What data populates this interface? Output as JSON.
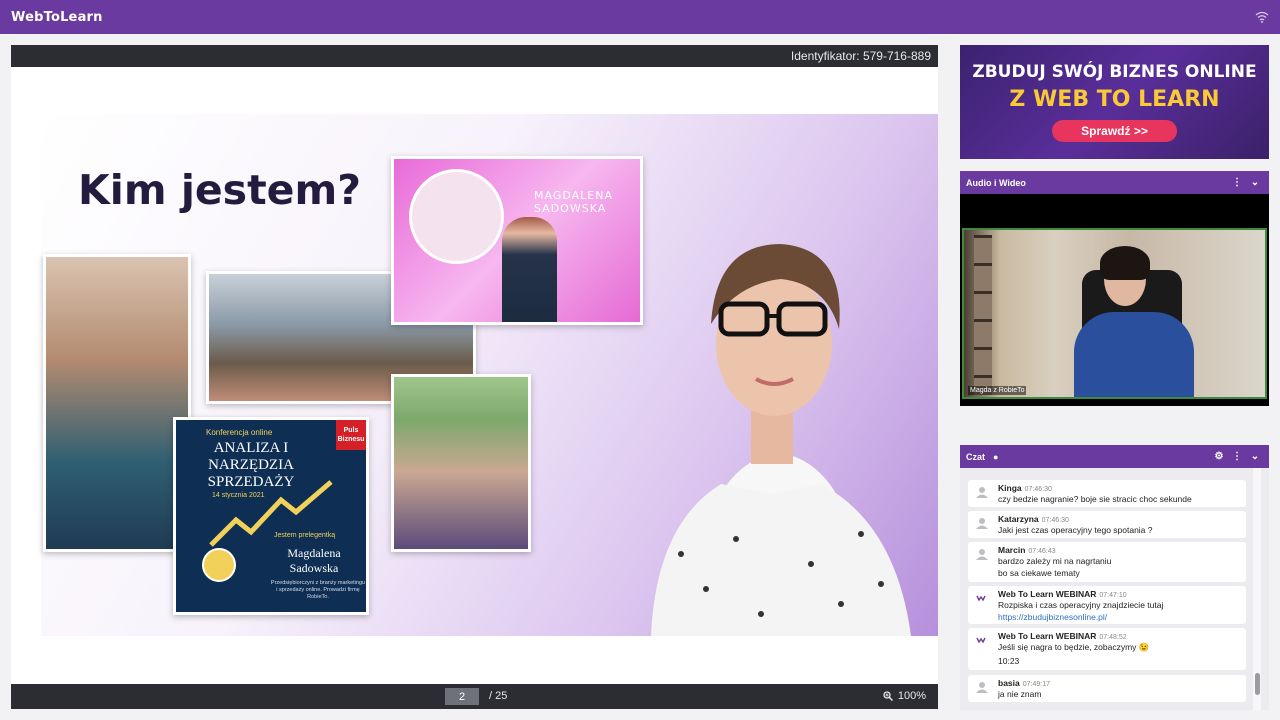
{
  "app": {
    "logo": "WebToLearn"
  },
  "presentation": {
    "identifier": "Identyfikator: 579-716-889",
    "page": "2",
    "page_total": "/ 25",
    "zoom": "100%",
    "slide": {
      "title": "Kim jestem?",
      "pink_card_name": "MAGDALENA SADOWSKA",
      "conference": {
        "kicker": "Konferencja online",
        "title": "ANALIZA I NARZĘDZIA SPRZEDAŻY",
        "date": "14 stycznia 2021",
        "badge": "Puls Biznesu",
        "speaker_label": "Jestem prelegentką",
        "speaker_name": "Magdalena Sadowska",
        "description": "Przedsiębiorczyni z branży marketingu i sprzedaży online. Prowadzi firmę RobieTo."
      }
    }
  },
  "ad": {
    "line1": "ZBUDUJ SWÓJ BIZNES ONLINE",
    "line2": "Z WEB TO LEARN",
    "button": "Sprawdź >>"
  },
  "video_panel": {
    "title": "Audio i Wideo",
    "label": "Magda z RobieTo"
  },
  "chat_panel": {
    "title": "Czat",
    "messages": [
      {
        "name": "Kinga",
        "time": "07:46:30",
        "lines": [
          "czy bedzie nagranie? boje sie stracic choc sekunde"
        ]
      },
      {
        "name": "Katarzyna",
        "time": "07:46:30",
        "lines": [
          "Jaki jest czas operacyjny tego spotania ?"
        ]
      },
      {
        "name": "Marcin",
        "time": "07:46:43",
        "lines": [
          "bardzo zależy mi na nagrtaniu",
          "bo sa ciekawe tematy"
        ]
      },
      {
        "name": "Web To Learn WEBINAR",
        "time": "07:47:10",
        "lines": [
          "Rozpiska i czas operacyjny znajdziecie tutaj"
        ],
        "link": "https://zbudujbiznesonline.pl/"
      },
      {
        "name": "Web To Learn WEBINAR",
        "time": "07:48:52",
        "lines": [
          "Jeśli się nagra to będzie, zobaczymy 😉",
          "10:23"
        ]
      },
      {
        "name": "basia",
        "time": "07:49:17",
        "lines": [
          "ja nie znam"
        ]
      }
    ]
  },
  "colors": {
    "brand": "#6b3aa0",
    "dark_bar": "#2b2d33",
    "accent_yellow": "#f9c936",
    "cta": "#e8355d"
  }
}
